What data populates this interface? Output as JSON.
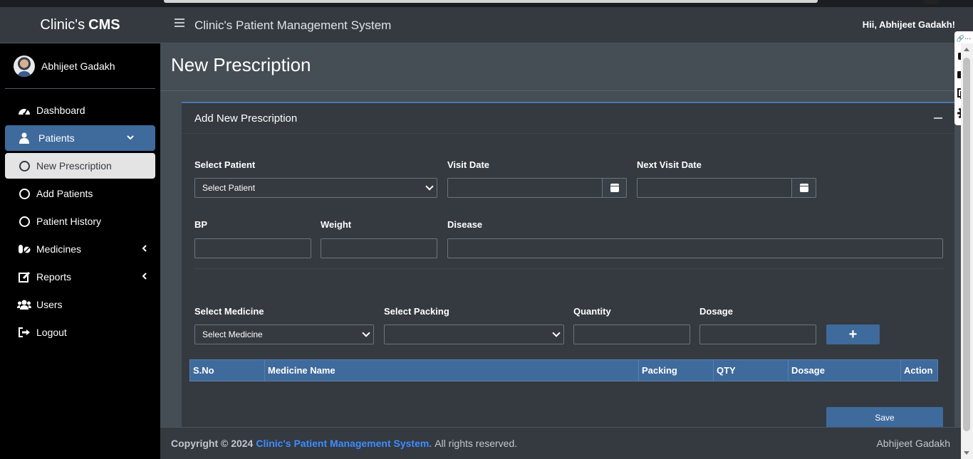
{
  "brand": {
    "light": "Clinic's",
    "bold": "CMS"
  },
  "user": {
    "name": "Abhijeet Gadakh"
  },
  "nav": [
    {
      "label": "Dashboard",
      "icon": "dashboard-icon"
    },
    {
      "label": "Patients",
      "icon": "patient-icon"
    },
    {
      "label": "New Prescription",
      "icon": "circle-icon"
    },
    {
      "label": "Add Patients",
      "icon": "circle-icon"
    },
    {
      "label": "Patient History",
      "icon": "circle-icon"
    },
    {
      "label": "Medicines",
      "icon": "pills-icon"
    },
    {
      "label": "Reports",
      "icon": "edit-icon"
    },
    {
      "label": "Users",
      "icon": "users-icon"
    },
    {
      "label": "Logout",
      "icon": "logout-icon"
    }
  ],
  "header": {
    "title": "Clinic's Patient Management System",
    "greeting": "Hii, Abhijeet Gadakh!"
  },
  "page": {
    "title": "New Prescription"
  },
  "card": {
    "title": "Add New Prescription"
  },
  "form": {
    "patient_label": "Select Patient",
    "patient_value": "Select Patient",
    "visit_date_label": "Visit Date",
    "next_visit_date_label": "Next Visit Date",
    "bp_label": "BP",
    "weight_label": "Weight",
    "disease_label": "Disease",
    "medicine_label": "Select Medicine",
    "medicine_value": "Select Medicine",
    "packing_label": "Select Packing",
    "quantity_label": "Quantity",
    "dosage_label": "Dosage",
    "add_button": "+"
  },
  "table": {
    "columns": [
      "S.No",
      "Medicine Name",
      "Packing",
      "QTY",
      "Dosage",
      "Action"
    ]
  },
  "save_button": "Save",
  "footer": {
    "copyright": "Copyright © 2024",
    "link": "Clinic's Patient Management System.",
    "rights": "All rights reserved.",
    "author": "Abhijeet Gadakh"
  },
  "colors": {
    "accent": "#3f6a9c",
    "sidebar_bg": "#000000",
    "content_bg": "#454d55",
    "card_bg": "#343a40",
    "link": "#3f8cff"
  }
}
